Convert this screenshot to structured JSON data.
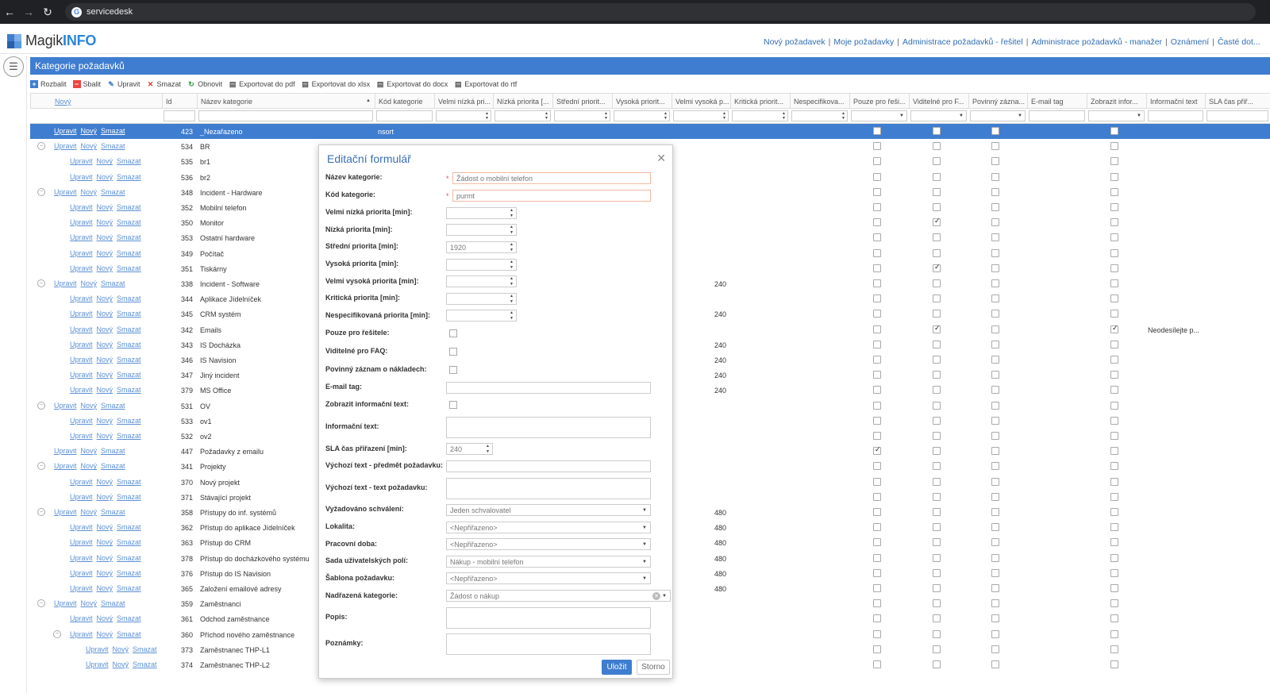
{
  "browser": {
    "url": "servicedesk"
  },
  "logo": {
    "part1": "Magik",
    "part2": "INFO"
  },
  "top_nav": [
    "Nový požadavek",
    "Moje požadavky",
    "Administrace požadavků - řešitel",
    "Administrace požadavků - manažer",
    "Oznámení",
    "Časté dot..."
  ],
  "panel": {
    "title": "Kategorie požadavků"
  },
  "toolbar": [
    {
      "label": "Rozbalit",
      "icon": "plus-icon"
    },
    {
      "label": "Sbalit",
      "icon": "minus-icon"
    },
    {
      "label": "Upravit",
      "icon": "edit-icon"
    },
    {
      "label": "Smazat",
      "icon": "delete-icon"
    },
    {
      "label": "Obnovit",
      "icon": "refresh-icon"
    },
    {
      "label": "Exportovat do pdf",
      "icon": "export-icon"
    },
    {
      "label": "Exportovat do xlsx",
      "icon": "export-icon"
    },
    {
      "label": "Exportovat do docx",
      "icon": "export-icon"
    },
    {
      "label": "Exportovat do rtf",
      "icon": "export-icon"
    }
  ],
  "grid": {
    "columns": [
      "Nový",
      "Id",
      "Název kategorie",
      "Kód kategorie",
      "Velmi nízká pri...",
      "Nízká priorita [...",
      "Střední priorit...",
      "Vysoká priorit...",
      "Velmi vysoká p...",
      "Kritická priorit...",
      "Nespecifikova...",
      "Pouze pro řeši...",
      "Viditelné pro F...",
      "Povinný zázna...",
      "E-mail tag",
      "Zobrazit infor...",
      "Informační text",
      "SLA čas přiř..."
    ],
    "action_labels": {
      "edit": "Upravit",
      "new": "Nový",
      "delete": "Smazat"
    },
    "rows": [
      {
        "level": 0,
        "expander": false,
        "id": "423",
        "name": "_Nezařazeno",
        "code": "nsort",
        "sla": "",
        "info": "",
        "selected": true,
        "visible_faq": false,
        "show_info": false,
        "only_solver": false
      },
      {
        "level": 0,
        "expander": true,
        "id": "534",
        "name": "BR",
        "code": "",
        "sla": "",
        "info": "",
        "selected": false,
        "visible_faq": false,
        "show_info": false,
        "only_solver": false
      },
      {
        "level": 1,
        "expander": false,
        "id": "535",
        "name": "br1",
        "code": "",
        "sla": "",
        "info": "",
        "selected": false,
        "visible_faq": false,
        "show_info": false,
        "only_solver": false
      },
      {
        "level": 1,
        "expander": false,
        "id": "536",
        "name": "br2",
        "code": "",
        "sla": "",
        "info": "",
        "selected": false,
        "visible_faq": false,
        "show_info": false,
        "only_solver": false
      },
      {
        "level": 0,
        "expander": true,
        "id": "348",
        "name": "Incident - Hardware",
        "code": "",
        "sla": "",
        "info": "",
        "selected": false,
        "visible_faq": false,
        "show_info": false,
        "only_solver": false
      },
      {
        "level": 1,
        "expander": false,
        "id": "352",
        "name": "Mobilní telefon",
        "code": "",
        "sla": "",
        "info": "",
        "selected": false,
        "visible_faq": false,
        "show_info": false,
        "only_solver": false
      },
      {
        "level": 1,
        "expander": false,
        "id": "350",
        "name": "Monitor",
        "code": "",
        "sla": "",
        "info": "",
        "selected": false,
        "visible_faq": true,
        "show_info": false,
        "only_solver": false
      },
      {
        "level": 1,
        "expander": false,
        "id": "353",
        "name": "Ostatní hardware",
        "code": "",
        "sla": "",
        "info": "",
        "selected": false,
        "visible_faq": false,
        "show_info": false,
        "only_solver": false
      },
      {
        "level": 1,
        "expander": false,
        "id": "349",
        "name": "Počítač",
        "code": "",
        "sla": "",
        "info": "",
        "selected": false,
        "visible_faq": false,
        "show_info": false,
        "only_solver": false
      },
      {
        "level": 1,
        "expander": false,
        "id": "351",
        "name": "Tiskárny",
        "code": "",
        "sla": "",
        "info": "",
        "selected": false,
        "visible_faq": true,
        "show_info": false,
        "only_solver": false
      },
      {
        "level": 0,
        "expander": true,
        "id": "338",
        "name": "Incident - Software",
        "code": "",
        "sla": "240",
        "info": "",
        "selected": false,
        "visible_faq": false,
        "show_info": false,
        "only_solver": false
      },
      {
        "level": 1,
        "expander": false,
        "id": "344",
        "name": "Aplikace Jídelníček",
        "code": "",
        "sla": "",
        "info": "",
        "selected": false,
        "visible_faq": false,
        "show_info": false,
        "only_solver": false
      },
      {
        "level": 1,
        "expander": false,
        "id": "345",
        "name": "CRM systém",
        "code": "",
        "sla": "240",
        "info": "",
        "selected": false,
        "visible_faq": false,
        "show_info": false,
        "only_solver": false
      },
      {
        "level": 1,
        "expander": false,
        "id": "342",
        "name": "Emails",
        "code": "",
        "sla": "",
        "info": "Neodesílejte p...",
        "selected": false,
        "visible_faq": true,
        "show_info": true,
        "only_solver": false
      },
      {
        "level": 1,
        "expander": false,
        "id": "343",
        "name": "IS Docházka",
        "code": "",
        "sla": "240",
        "info": "",
        "selected": false,
        "visible_faq": false,
        "show_info": false,
        "only_solver": false
      },
      {
        "level": 1,
        "expander": false,
        "id": "346",
        "name": "IS Navision",
        "code": "",
        "sla": "240",
        "info": "",
        "selected": false,
        "visible_faq": false,
        "show_info": false,
        "only_solver": false
      },
      {
        "level": 1,
        "expander": false,
        "id": "347",
        "name": "Jiný incident",
        "code": "",
        "sla": "240",
        "info": "",
        "selected": false,
        "visible_faq": false,
        "show_info": false,
        "only_solver": false
      },
      {
        "level": 1,
        "expander": false,
        "id": "379",
        "name": "MS Office",
        "code": "",
        "sla": "240",
        "info": "",
        "selected": false,
        "visible_faq": false,
        "show_info": false,
        "only_solver": false
      },
      {
        "level": 0,
        "expander": true,
        "id": "531",
        "name": "OV",
        "code": "",
        "sla": "",
        "info": "",
        "selected": false,
        "visible_faq": false,
        "show_info": false,
        "only_solver": false
      },
      {
        "level": 1,
        "expander": false,
        "id": "533",
        "name": "ov1",
        "code": "",
        "sla": "",
        "info": "",
        "selected": false,
        "visible_faq": false,
        "show_info": false,
        "only_solver": false
      },
      {
        "level": 1,
        "expander": false,
        "id": "532",
        "name": "ov2",
        "code": "",
        "sla": "",
        "info": "",
        "selected": false,
        "visible_faq": false,
        "show_info": false,
        "only_solver": false
      },
      {
        "level": 0,
        "expander": false,
        "id": "447",
        "name": "Požadavky z emailu",
        "code": "",
        "sla": "",
        "info": "",
        "selected": false,
        "visible_faq": false,
        "show_info": false,
        "only_solver": true
      },
      {
        "level": 0,
        "expander": true,
        "id": "341",
        "name": "Projekty",
        "code": "",
        "sla": "",
        "info": "",
        "selected": false,
        "visible_faq": false,
        "show_info": false,
        "only_solver": false
      },
      {
        "level": 1,
        "expander": false,
        "id": "370",
        "name": "Nový projekt",
        "code": "",
        "sla": "",
        "info": "",
        "selected": false,
        "visible_faq": false,
        "show_info": false,
        "only_solver": false
      },
      {
        "level": 1,
        "expander": false,
        "id": "371",
        "name": "Stávající projekt",
        "code": "",
        "sla": "",
        "info": "",
        "selected": false,
        "visible_faq": false,
        "show_info": false,
        "only_solver": false
      },
      {
        "level": 0,
        "expander": true,
        "id": "358",
        "name": "Přístupy do inf. systémů",
        "code": "",
        "sla": "480",
        "info": "",
        "selected": false,
        "visible_faq": false,
        "show_info": false,
        "only_solver": false
      },
      {
        "level": 1,
        "expander": false,
        "id": "362",
        "name": "Přístup do aplikace Jídelníček",
        "code": "",
        "sla": "480",
        "info": "",
        "selected": false,
        "visible_faq": false,
        "show_info": false,
        "only_solver": false
      },
      {
        "level": 1,
        "expander": false,
        "id": "363",
        "name": "Přístup do CRM",
        "code": "",
        "sla": "480",
        "info": "",
        "selected": false,
        "visible_faq": false,
        "show_info": false,
        "only_solver": false
      },
      {
        "level": 1,
        "expander": false,
        "id": "378",
        "name": "Přístup do docházkového systému",
        "code": "",
        "sla": "480",
        "info": "",
        "selected": false,
        "visible_faq": false,
        "show_info": false,
        "only_solver": false
      },
      {
        "level": 1,
        "expander": false,
        "id": "376",
        "name": "Přístup do IS Navision",
        "code": "",
        "sla": "480",
        "info": "",
        "selected": false,
        "visible_faq": false,
        "show_info": false,
        "only_solver": false
      },
      {
        "level": 1,
        "expander": false,
        "id": "365",
        "name": "Založení emailové adresy",
        "code": "",
        "sla": "480",
        "info": "",
        "selected": false,
        "visible_faq": false,
        "show_info": false,
        "only_solver": false
      },
      {
        "level": 0,
        "expander": true,
        "id": "359",
        "name": "Zaměstnanci",
        "code": "",
        "sla": "",
        "info": "",
        "selected": false,
        "visible_faq": false,
        "show_info": false,
        "only_solver": false
      },
      {
        "level": 1,
        "expander": false,
        "id": "361",
        "name": "Odchod zaměstnance",
        "code": "",
        "sla": "",
        "info": "",
        "selected": false,
        "visible_faq": false,
        "show_info": false,
        "only_solver": false
      },
      {
        "level": 1,
        "expander": true,
        "id": "360",
        "name": "Příchod nového zaměstnance",
        "code": "",
        "sla": "",
        "info": "",
        "selected": false,
        "visible_faq": false,
        "show_info": false,
        "only_solver": false
      },
      {
        "level": 2,
        "expander": false,
        "id": "373",
        "name": "Zaměstnanec THP-L1",
        "code": "",
        "sla": "",
        "info": "",
        "selected": false,
        "visible_faq": false,
        "show_info": false,
        "only_solver": false
      },
      {
        "level": 2,
        "expander": false,
        "id": "374",
        "name": "Zaměstnanec THP-L2",
        "code": "",
        "sla": "",
        "info": "",
        "selected": false,
        "visible_faq": false,
        "show_info": false,
        "only_solver": false
      }
    ]
  },
  "modal": {
    "title": "Editační formulář",
    "fields": {
      "name": {
        "label": "Název kategorie:",
        "value": "Žádost o mobilní telefon"
      },
      "code": {
        "label": "Kód kategorie:",
        "value": "purmt"
      },
      "very_low": {
        "label": "Velmi nízká priorita [min]:",
        "value": ""
      },
      "low": {
        "label": "Nízká priorita [min]:",
        "value": ""
      },
      "medium": {
        "label": "Střední priorita [min]:",
        "value": "1920"
      },
      "high": {
        "label": "Vysoká priorita [min]:",
        "value": ""
      },
      "very_high": {
        "label": "Velmi vysoká priorita [min]:",
        "value": ""
      },
      "critical": {
        "label": "Kritická priorita [min]:",
        "value": ""
      },
      "unspecified": {
        "label": "Nespecifikovaná priorita [min]:",
        "value": ""
      },
      "only_solver": {
        "label": "Pouze pro řešitele:"
      },
      "visible_faq": {
        "label": "Viditelné pro FAQ:"
      },
      "cost_record": {
        "label": "Povinný záznam o nákladech:"
      },
      "email_tag": {
        "label": "E-mail tag:",
        "value": ""
      },
      "show_info": {
        "label": "Zobrazit informační text:"
      },
      "info_text": {
        "label": "Informační text:"
      },
      "sla": {
        "label": "SLA čas přiřazení [min]:",
        "value": "240"
      },
      "default_subject": {
        "label": "Výchozí text - předmět požadavku:",
        "value": ""
      },
      "default_text": {
        "label": "Výchozí text - text požadavku:"
      },
      "approval": {
        "label": "Vyžadováno schválení:",
        "value": "Jeden schvalovatel"
      },
      "locality": {
        "label": "Lokalita:",
        "value": "<Nepřiřazeno>"
      },
      "work_time": {
        "label": "Pracovní doba:",
        "value": "<Nepřiřazeno>"
      },
      "user_fields": {
        "label": "Sada uživatelských polí:",
        "value": "Nákup - mobilní telefon"
      },
      "template": {
        "label": "Šablona požadavku:",
        "value": "<Nepřiřazeno>"
      },
      "parent": {
        "label": "Nadřazená kategorie:",
        "value": "Žádost o nákup"
      },
      "description": {
        "label": "Popis:"
      },
      "notes": {
        "label": "Poznámky:"
      }
    },
    "save_label": "Uložit",
    "cancel_label": "Storno"
  }
}
